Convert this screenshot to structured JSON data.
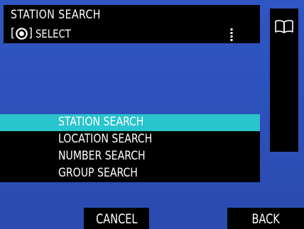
{
  "header": {
    "title": "STATION SEARCH",
    "bracket_open": "[",
    "bracket_close": "]",
    "dial_icon": "dial-knob-icon",
    "select_label": "SELECT",
    "scroll_icon": "vertical-scroll-dots-icon"
  },
  "side": {
    "icon": "book-icon"
  },
  "menu": {
    "selected_index": 0,
    "items": [
      {
        "label": "STATION SEARCH"
      },
      {
        "label": "LOCATION SEARCH"
      },
      {
        "label": "NUMBER SEARCH"
      },
      {
        "label": "GROUP SEARCH"
      }
    ]
  },
  "softkeys": {
    "cancel_label": "CANCEL",
    "back_label": "BACK"
  },
  "colors": {
    "background": "#2f56c4",
    "panel": "#000000",
    "highlight": "#29c4cc",
    "text": "#ffffff"
  }
}
